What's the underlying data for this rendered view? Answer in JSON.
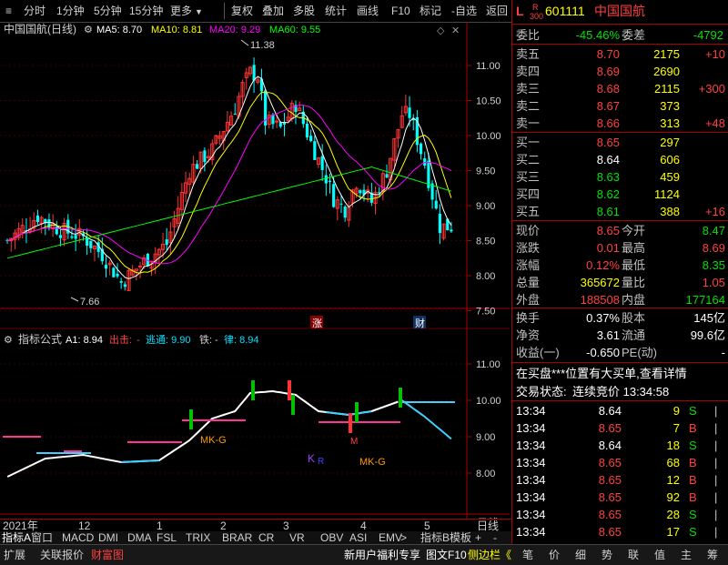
{
  "toolbar": {
    "left_items": [
      "分时",
      "1分钟",
      "5分钟",
      "15分钟",
      "更多"
    ],
    "right_items": [
      "复权",
      "叠加",
      "多股",
      "统计",
      "画线",
      "F10",
      "标记",
      "-自选",
      "返回"
    ]
  },
  "chart": {
    "title": "中国国航(日线)",
    "ma5": "MA5: 8.70",
    "ma10": "MA10: 8.81",
    "ma20": "MA20: 9.29",
    "ma60": "MA60: 9.55",
    "high_label": "11.38",
    "low_label": "7.66",
    "price_ticks": [
      "11.00",
      "10.50",
      "10.00",
      "9.50",
      "9.00",
      "8.50",
      "8.00",
      "7.50"
    ],
    "marker_zhang": "涨",
    "marker_cai": "财",
    "colors": {
      "ma5": "#ffffff",
      "ma10": "#ffff00",
      "ma20": "#ff00ff",
      "ma60": "#00ff00",
      "up": "#ff3333",
      "down": "#00ffff"
    }
  },
  "indicator": {
    "name": "指标公式",
    "a1": "A1: 8.94",
    "chuji_label": "出击:",
    "chuji_value": "-",
    "taotong": "逃通: 9.90",
    "tie_label": "铁:",
    "tie_value": "-",
    "lv": "律: 8.94",
    "ticks": [
      "11.00",
      "10.00",
      "9.00",
      "8.00"
    ],
    "mk_g_1": "MK-G",
    "mk_g_2": "MK-G",
    "k_label": "K",
    "r_label": "R",
    "m_label": "M"
  },
  "time_axis": {
    "labels": [
      "2021年",
      "12",
      "1",
      "2",
      "3",
      "4",
      "5"
    ],
    "period": "日线"
  },
  "indicator_tabs": [
    "指标A",
    "窗口",
    "MACD",
    "DMI",
    "DMA",
    "FSL",
    "TRIX",
    "BRAR",
    "CR",
    "VR",
    "OBV",
    "ASI",
    "EMV",
    ">",
    "指标B",
    "模板"
  ],
  "tab_buttons": [
    "+",
    "-"
  ],
  "statusbar": {
    "left": [
      "扩展",
      "关联报价",
      "财富图"
    ],
    "center": [
      "新用户福利专享",
      "图文F10",
      "侧边栏《"
    ],
    "right": [
      "笔",
      "价",
      "细",
      "势",
      "联",
      "值",
      "主",
      "筹"
    ]
  },
  "quote": {
    "prefix_l": "L",
    "prefix_r": "R",
    "prefix_num": "300",
    "code": "601111",
    "name": "中国国航",
    "weibi_label": "委比",
    "weibi_value": "-45.46%",
    "weicha_label": "委差",
    "weicha_value": "-4792",
    "asks": [
      {
        "label": "卖五",
        "price": "8.70",
        "vol": "2175",
        "chg": "+10"
      },
      {
        "label": "卖四",
        "price": "8.69",
        "vol": "2690",
        "chg": ""
      },
      {
        "label": "卖三",
        "price": "8.68",
        "vol": "2115",
        "chg": "+300"
      },
      {
        "label": "卖二",
        "price": "8.67",
        "vol": "373",
        "chg": ""
      },
      {
        "label": "卖一",
        "price": "8.66",
        "vol": "313",
        "chg": "+48"
      }
    ],
    "bids": [
      {
        "label": "买一",
        "price": "8.65",
        "vol": "297",
        "chg": ""
      },
      {
        "label": "买二",
        "price": "8.64",
        "vol": "606",
        "chg": ""
      },
      {
        "label": "买三",
        "price": "8.63",
        "vol": "459",
        "chg": ""
      },
      {
        "label": "买四",
        "price": "8.62",
        "vol": "1124",
        "chg": ""
      },
      {
        "label": "买五",
        "price": "8.61",
        "vol": "388",
        "chg": "+16"
      }
    ],
    "stats": [
      {
        "l1": "现价",
        "v1": "8.65",
        "l2": "今开",
        "v2": "8.47"
      },
      {
        "l1": "涨跌",
        "v1": "0.01",
        "l2": "最高",
        "v2": "8.69"
      },
      {
        "l1": "涨幅",
        "v1": "0.12%",
        "l2": "最低",
        "v2": "8.35"
      },
      {
        "l1": "总量",
        "v1": "365672",
        "l2": "量比",
        "v2": "1.05"
      },
      {
        "l1": "外盘",
        "v1": "188508",
        "l2": "内盘",
        "v2": "177164"
      }
    ],
    "stats2": [
      {
        "l1": "换手",
        "v1": "0.37%",
        "l2": "股本",
        "v2": "145亿"
      },
      {
        "l1": "净资",
        "v1": "3.61",
        "l2": "流通",
        "v2": "99.6亿"
      },
      {
        "l1": "收益(一)",
        "v1": "-0.650",
        "l2": "PE(动)",
        "v2": "-"
      }
    ],
    "notice": "在买盘***位置有大买单,查看详情",
    "trade_status_label": "交易状态:",
    "trade_status_value": "连续竞价 13:34:58",
    "ticks": [
      {
        "time": "13:34",
        "price": "8.64",
        "vol": "9",
        "side": "S"
      },
      {
        "time": "13:34",
        "price": "8.65",
        "vol": "7",
        "side": "B"
      },
      {
        "time": "13:34",
        "price": "8.64",
        "vol": "18",
        "side": "S"
      },
      {
        "time": "13:34",
        "price": "8.65",
        "vol": "68",
        "side": "B"
      },
      {
        "time": "13:34",
        "price": "8.65",
        "vol": "12",
        "side": "B"
      },
      {
        "time": "13:34",
        "price": "8.65",
        "vol": "92",
        "side": "B"
      },
      {
        "time": "13:34",
        "price": "8.65",
        "vol": "28",
        "side": "S"
      },
      {
        "time": "13:34",
        "price": "8.65",
        "vol": "17",
        "side": "S"
      }
    ]
  }
}
